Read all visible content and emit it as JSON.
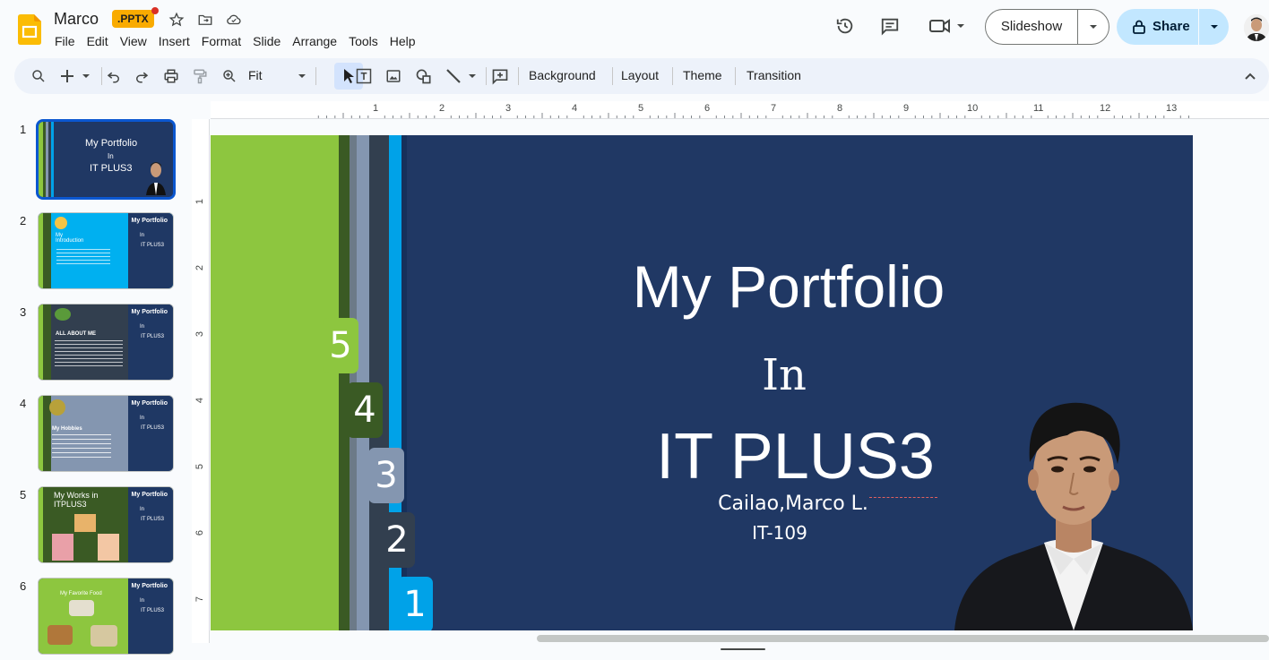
{
  "header": {
    "doc_title": "Marco",
    "file_badge": ".PPTX",
    "menu": [
      "File",
      "Edit",
      "View",
      "Insert",
      "Format",
      "Slide",
      "Arrange",
      "Tools",
      "Help"
    ],
    "slideshow_label": "Slideshow",
    "share_label": "Share"
  },
  "toolbar": {
    "zoom_label": "Fit",
    "background_label": "Background",
    "layout_label": "Layout",
    "theme_label": "Theme",
    "transition_label": "Transition"
  },
  "filmstrip": [
    {
      "num": "1",
      "title": "My Portfolio",
      "line2": "In",
      "line3": "IT PLUS3",
      "selected": true
    },
    {
      "num": "2",
      "title": "My Portfolio",
      "body": "My Introduction",
      "line2": "In",
      "line3": "IT PLUS3"
    },
    {
      "num": "3",
      "title": "My Portfolio",
      "body": "ALL ABOUT ME",
      "line2": "In",
      "line3": "IT PLUS3"
    },
    {
      "num": "4",
      "title": "My Portfolio",
      "body": "My Hobbies",
      "line2": "In",
      "line3": "IT PLUS3"
    },
    {
      "num": "5",
      "title": "My Portfolio",
      "body": "My Works in ITPLUS3",
      "line2": "In",
      "line3": "IT PLUS3"
    },
    {
      "num": "6",
      "title": "My Portfolio",
      "body": "My Favorite Food",
      "line2": "In",
      "line3": "IT PLUS3"
    }
  ],
  "ruler": {
    "h": [
      "1",
      "2",
      "3",
      "4",
      "5",
      "6",
      "7",
      "8",
      "9",
      "10",
      "11",
      "12",
      "13"
    ],
    "v": [
      "1",
      "2",
      "3",
      "4",
      "5",
      "6",
      "7"
    ]
  },
  "slide": {
    "title": "My Portfolio",
    "in": "In",
    "course": "IT PLUS3",
    "name": "Cailao,Marco L.",
    "section": "IT-109",
    "tabs": [
      "5",
      "4",
      "3",
      "2",
      "1"
    ],
    "colors": {
      "background": "#203864",
      "green": "#8dc63f",
      "dark_green": "#3a5a24",
      "gray_blue": "#8496b0",
      "slate": "#323f4f",
      "cyan": "#00a2e8"
    }
  }
}
